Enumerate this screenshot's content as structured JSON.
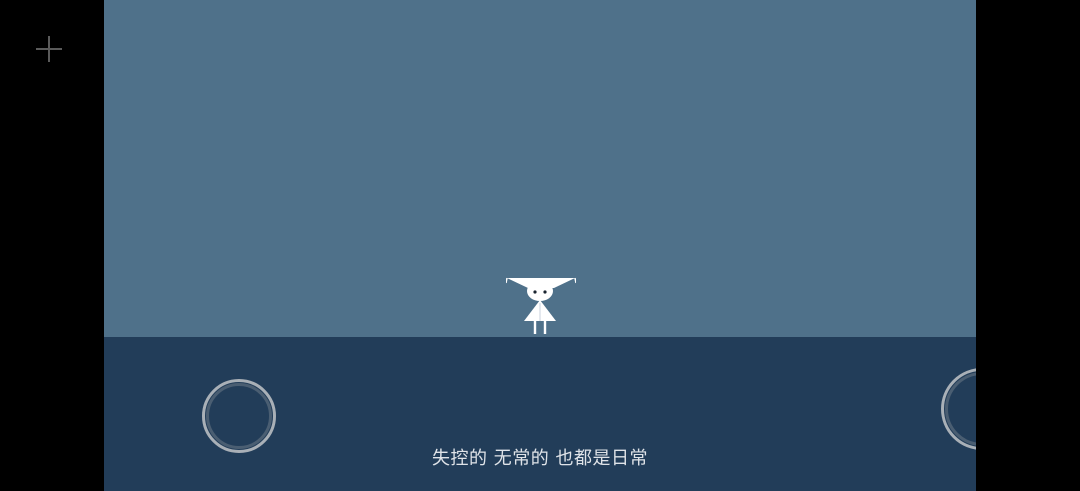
{
  "game": {
    "subtitle": "失控的 无常的 也都是日常"
  },
  "colors": {
    "sky": "#4f718a",
    "ground": "#223d59",
    "letterbox": "#000000",
    "character": "#ffffff",
    "subtitle_text": "#dfe3e8"
  },
  "icons": {
    "menu": "crosshair-icon",
    "left_control": "virtual-joystick-left",
    "right_control": "virtual-joystick-right"
  }
}
